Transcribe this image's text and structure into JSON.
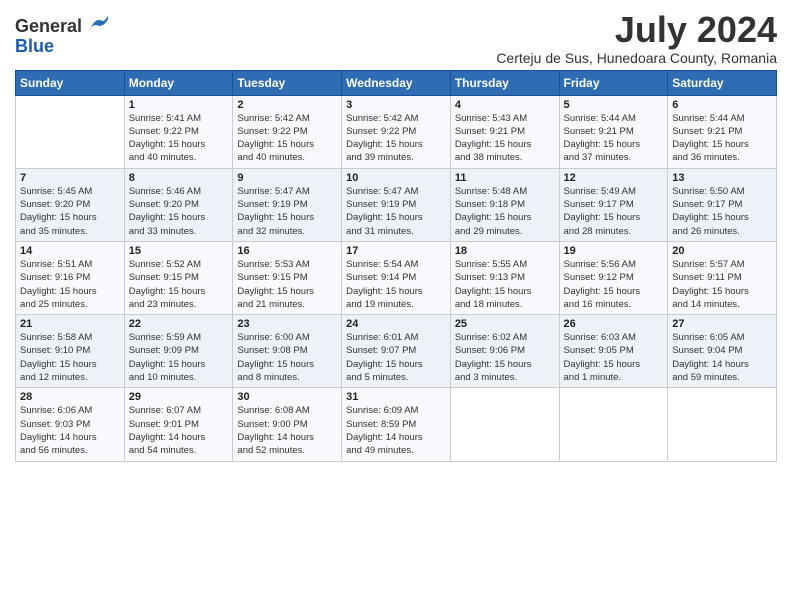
{
  "header": {
    "logo_general": "General",
    "logo_blue": "Blue",
    "month": "July 2024",
    "location": "Certeju de Sus, Hunedoara County, Romania"
  },
  "weekdays": [
    "Sunday",
    "Monday",
    "Tuesday",
    "Wednesday",
    "Thursday",
    "Friday",
    "Saturday"
  ],
  "weeks": [
    [
      {
        "day": "",
        "info": ""
      },
      {
        "day": "1",
        "info": "Sunrise: 5:41 AM\nSunset: 9:22 PM\nDaylight: 15 hours\nand 40 minutes."
      },
      {
        "day": "2",
        "info": "Sunrise: 5:42 AM\nSunset: 9:22 PM\nDaylight: 15 hours\nand 40 minutes."
      },
      {
        "day": "3",
        "info": "Sunrise: 5:42 AM\nSunset: 9:22 PM\nDaylight: 15 hours\nand 39 minutes."
      },
      {
        "day": "4",
        "info": "Sunrise: 5:43 AM\nSunset: 9:21 PM\nDaylight: 15 hours\nand 38 minutes."
      },
      {
        "day": "5",
        "info": "Sunrise: 5:44 AM\nSunset: 9:21 PM\nDaylight: 15 hours\nand 37 minutes."
      },
      {
        "day": "6",
        "info": "Sunrise: 5:44 AM\nSunset: 9:21 PM\nDaylight: 15 hours\nand 36 minutes."
      }
    ],
    [
      {
        "day": "7",
        "info": "Sunrise: 5:45 AM\nSunset: 9:20 PM\nDaylight: 15 hours\nand 35 minutes."
      },
      {
        "day": "8",
        "info": "Sunrise: 5:46 AM\nSunset: 9:20 PM\nDaylight: 15 hours\nand 33 minutes."
      },
      {
        "day": "9",
        "info": "Sunrise: 5:47 AM\nSunset: 9:19 PM\nDaylight: 15 hours\nand 32 minutes."
      },
      {
        "day": "10",
        "info": "Sunrise: 5:47 AM\nSunset: 9:19 PM\nDaylight: 15 hours\nand 31 minutes."
      },
      {
        "day": "11",
        "info": "Sunrise: 5:48 AM\nSunset: 9:18 PM\nDaylight: 15 hours\nand 29 minutes."
      },
      {
        "day": "12",
        "info": "Sunrise: 5:49 AM\nSunset: 9:17 PM\nDaylight: 15 hours\nand 28 minutes."
      },
      {
        "day": "13",
        "info": "Sunrise: 5:50 AM\nSunset: 9:17 PM\nDaylight: 15 hours\nand 26 minutes."
      }
    ],
    [
      {
        "day": "14",
        "info": "Sunrise: 5:51 AM\nSunset: 9:16 PM\nDaylight: 15 hours\nand 25 minutes."
      },
      {
        "day": "15",
        "info": "Sunrise: 5:52 AM\nSunset: 9:15 PM\nDaylight: 15 hours\nand 23 minutes."
      },
      {
        "day": "16",
        "info": "Sunrise: 5:53 AM\nSunset: 9:15 PM\nDaylight: 15 hours\nand 21 minutes."
      },
      {
        "day": "17",
        "info": "Sunrise: 5:54 AM\nSunset: 9:14 PM\nDaylight: 15 hours\nand 19 minutes."
      },
      {
        "day": "18",
        "info": "Sunrise: 5:55 AM\nSunset: 9:13 PM\nDaylight: 15 hours\nand 18 minutes."
      },
      {
        "day": "19",
        "info": "Sunrise: 5:56 AM\nSunset: 9:12 PM\nDaylight: 15 hours\nand 16 minutes."
      },
      {
        "day": "20",
        "info": "Sunrise: 5:57 AM\nSunset: 9:11 PM\nDaylight: 15 hours\nand 14 minutes."
      }
    ],
    [
      {
        "day": "21",
        "info": "Sunrise: 5:58 AM\nSunset: 9:10 PM\nDaylight: 15 hours\nand 12 minutes."
      },
      {
        "day": "22",
        "info": "Sunrise: 5:59 AM\nSunset: 9:09 PM\nDaylight: 15 hours\nand 10 minutes."
      },
      {
        "day": "23",
        "info": "Sunrise: 6:00 AM\nSunset: 9:08 PM\nDaylight: 15 hours\nand 8 minutes."
      },
      {
        "day": "24",
        "info": "Sunrise: 6:01 AM\nSunset: 9:07 PM\nDaylight: 15 hours\nand 5 minutes."
      },
      {
        "day": "25",
        "info": "Sunrise: 6:02 AM\nSunset: 9:06 PM\nDaylight: 15 hours\nand 3 minutes."
      },
      {
        "day": "26",
        "info": "Sunrise: 6:03 AM\nSunset: 9:05 PM\nDaylight: 15 hours\nand 1 minute."
      },
      {
        "day": "27",
        "info": "Sunrise: 6:05 AM\nSunset: 9:04 PM\nDaylight: 14 hours\nand 59 minutes."
      }
    ],
    [
      {
        "day": "28",
        "info": "Sunrise: 6:06 AM\nSunset: 9:03 PM\nDaylight: 14 hours\nand 56 minutes."
      },
      {
        "day": "29",
        "info": "Sunrise: 6:07 AM\nSunset: 9:01 PM\nDaylight: 14 hours\nand 54 minutes."
      },
      {
        "day": "30",
        "info": "Sunrise: 6:08 AM\nSunset: 9:00 PM\nDaylight: 14 hours\nand 52 minutes."
      },
      {
        "day": "31",
        "info": "Sunrise: 6:09 AM\nSunset: 8:59 PM\nDaylight: 14 hours\nand 49 minutes."
      },
      {
        "day": "",
        "info": ""
      },
      {
        "day": "",
        "info": ""
      },
      {
        "day": "",
        "info": ""
      }
    ]
  ]
}
